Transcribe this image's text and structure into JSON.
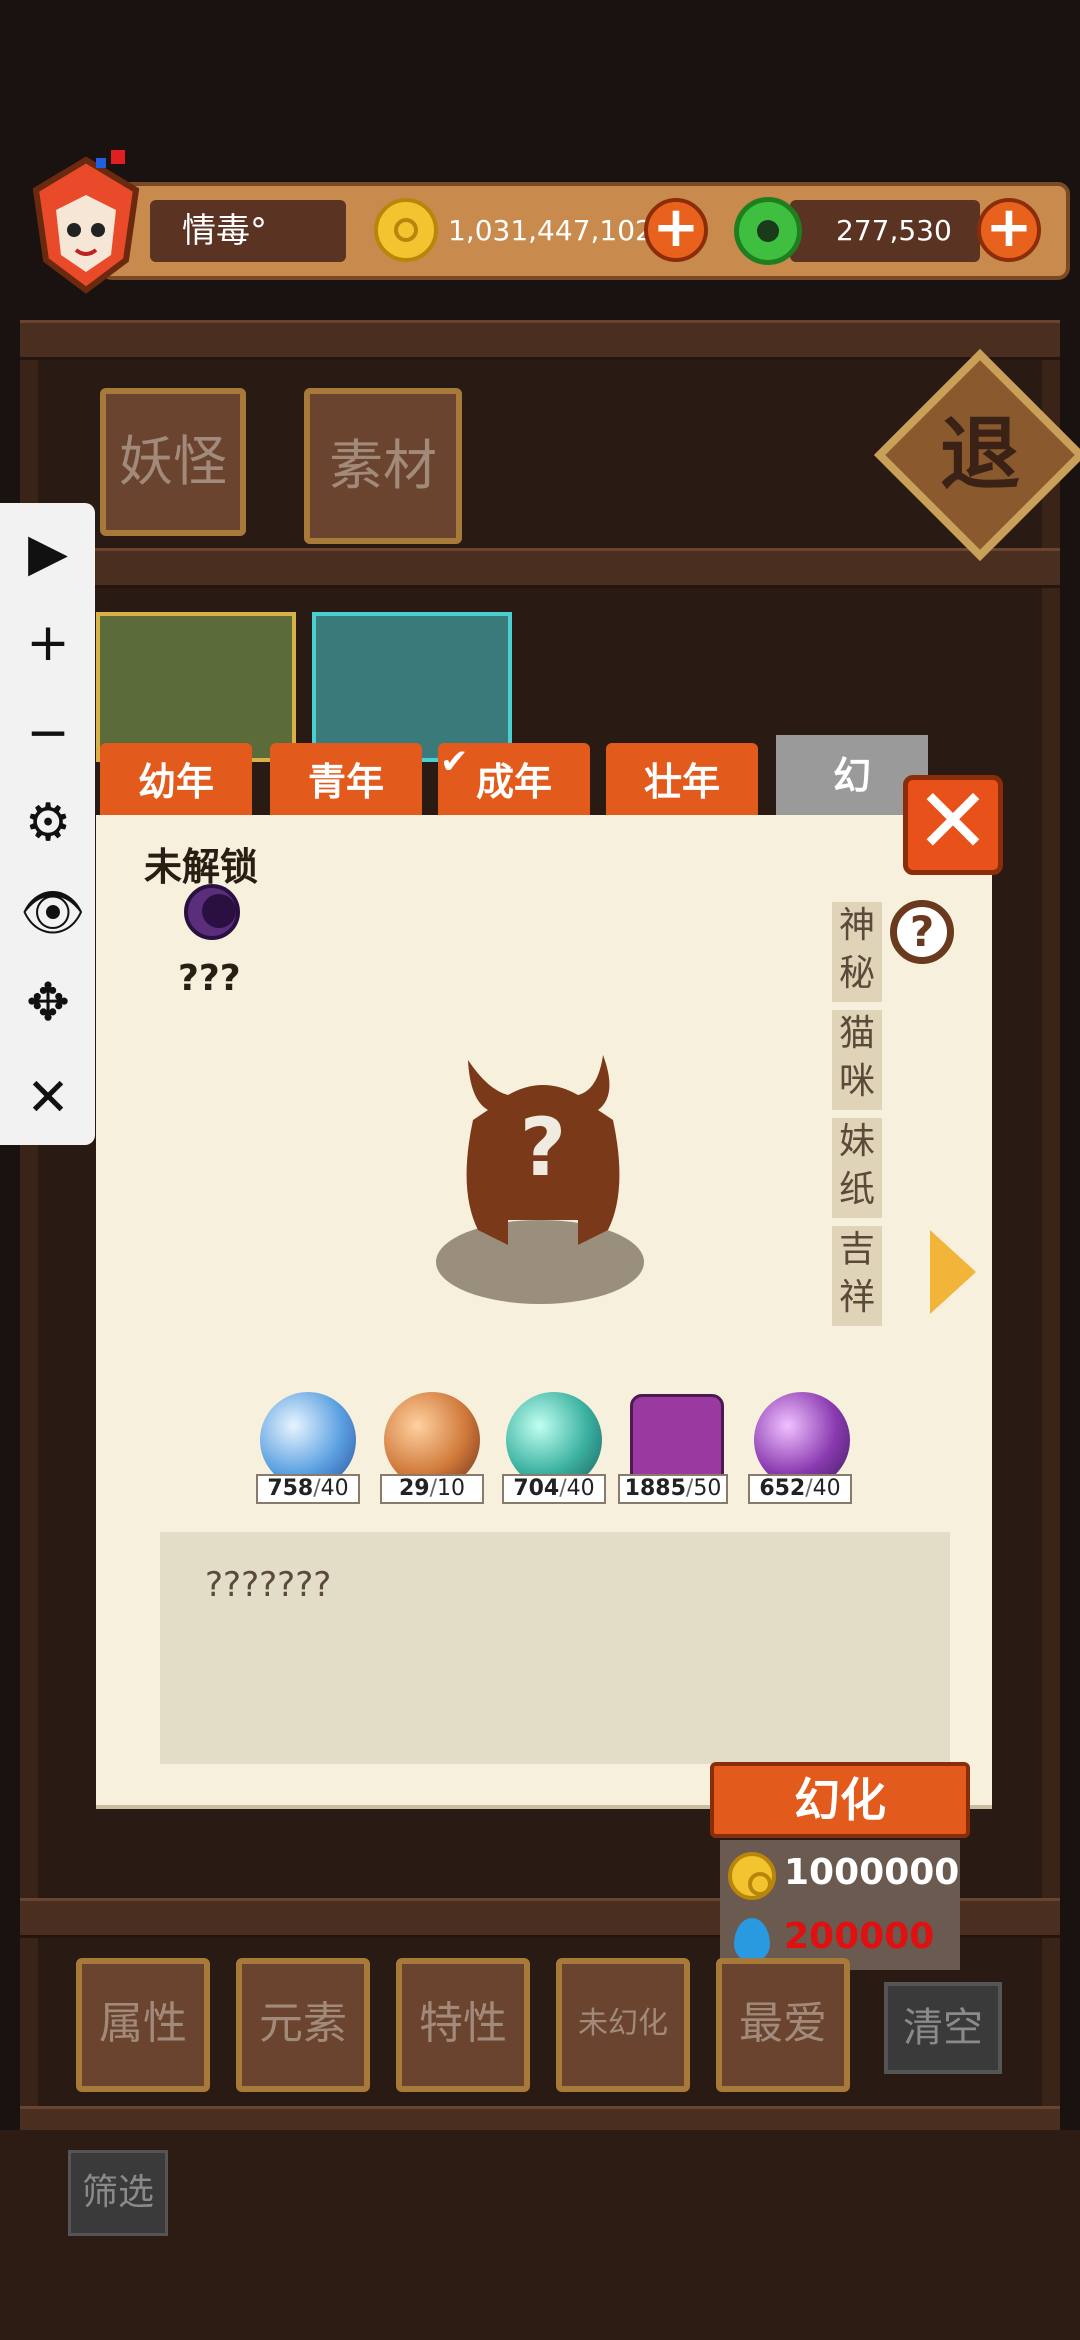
{
  "player": {
    "name": "情毒°"
  },
  "resources": {
    "gold": "1,031,447,102",
    "jade": "277,530"
  },
  "exit_label": "退",
  "top_tabs": [
    "妖怪",
    "素材"
  ],
  "age_tabs": [
    "幼年",
    "青年",
    "成年",
    "壮年",
    "幻"
  ],
  "panel": {
    "status": "未解锁",
    "creature_name": "???",
    "categories": [
      "神秘",
      "猫咪",
      "妹纸",
      "吉祥"
    ],
    "description": "???????"
  },
  "materials": [
    {
      "owned": "758",
      "need": "40",
      "color": "#5aa0e0",
      "icon": "crystal-cube-orb"
    },
    {
      "owned": "29",
      "need": "10",
      "color": "#d07a3a",
      "icon": "flame-feather-orb"
    },
    {
      "owned": "704",
      "need": "40",
      "color": "#3ab0a0",
      "icon": "teal-eye-orb"
    },
    {
      "owned": "1885",
      "need": "50",
      "color": "#9a3aa0",
      "icon": "purple-rune-block"
    },
    {
      "owned": "652",
      "need": "40",
      "color": "#8a3ab0",
      "icon": "swirl-orb"
    }
  ],
  "transform": {
    "label": "幻化",
    "gold_cost": "1000000",
    "blue_cost": "200000",
    "blue_cost_color": "#e01010"
  },
  "filters": [
    "属性",
    "元素",
    "特性",
    "未幻化",
    "最爱"
  ],
  "clear_label": "清空",
  "sift_label": "筛选",
  "colors": {
    "accent": "#e25a1c",
    "paper": "#f7f0dc"
  }
}
